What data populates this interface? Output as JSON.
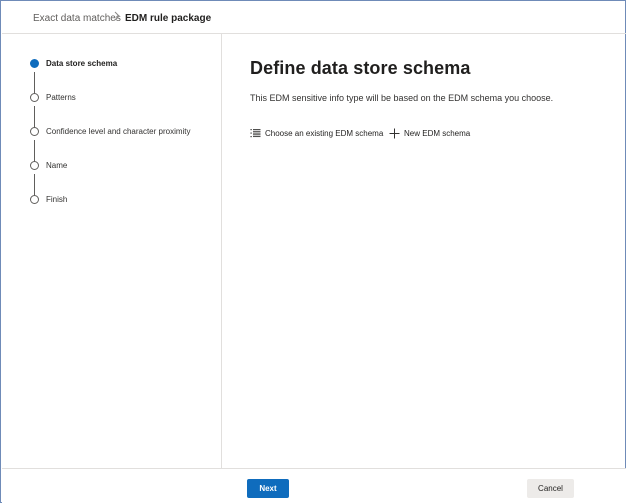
{
  "breadcrumb": {
    "items": [
      "Exact data matches",
      "EDM rule package"
    ]
  },
  "wizard": {
    "steps": [
      {
        "label": "Data store schema",
        "active": true
      },
      {
        "label": "Patterns",
        "active": false
      },
      {
        "label": "Confidence level and character proximity",
        "active": false
      },
      {
        "label": "Name",
        "active": false
      },
      {
        "label": "Finish",
        "active": false
      }
    ]
  },
  "main": {
    "title": "Define data store schema",
    "description": "This EDM sensitive info type will be based on the EDM schema you choose.",
    "actions": [
      {
        "label": "Choose an existing EDM schema",
        "icon": "list-icon"
      },
      {
        "label": "New EDM schema",
        "icon": "plus-icon"
      }
    ]
  },
  "footer": {
    "next_label": "Next",
    "cancel_label": "Cancel"
  },
  "colors": {
    "accent": "#0f6cbd",
    "border": "#e1dfdd",
    "text": "#323130"
  }
}
